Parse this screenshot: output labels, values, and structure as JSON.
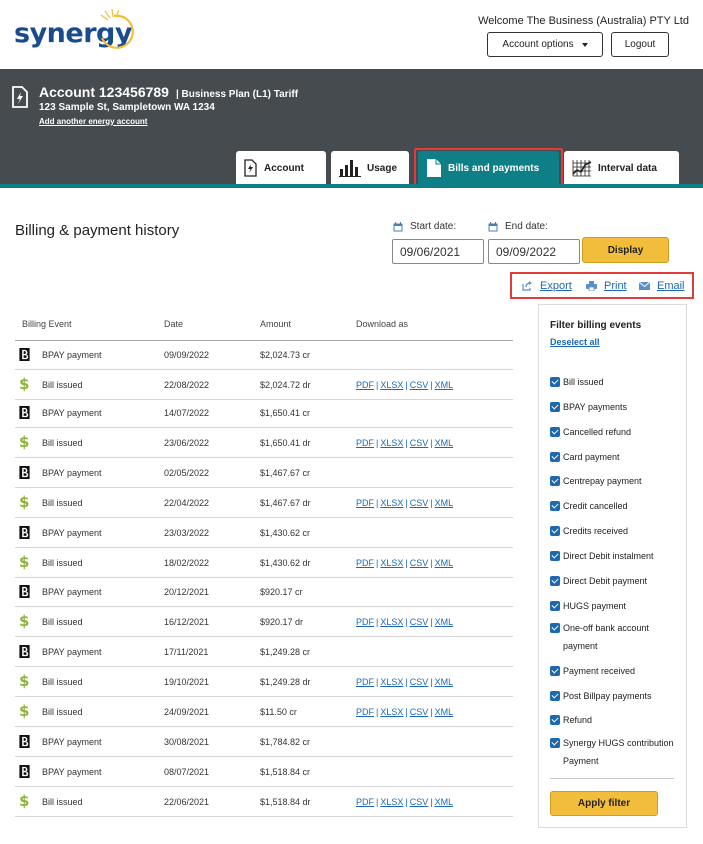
{
  "header": {
    "logo_text": "synergy",
    "welcome": "Welcome The Business (Australia) PTY Ltd",
    "account_options_label": "Account options",
    "logout_label": "Logout"
  },
  "account": {
    "number": "Account 123456789",
    "plan": "| Business Plan (L1) Tariff",
    "address": "123 Sample St, Sampletown WA 1234",
    "add_link": "Add another energy account"
  },
  "tabs": [
    {
      "label": "Account",
      "icon": "bolt-document-icon",
      "active": false
    },
    {
      "label": "Usage",
      "icon": "bar-chart-icon",
      "active": false
    },
    {
      "label": "Bills and payments",
      "icon": "document-icon",
      "active": true
    },
    {
      "label": "Interval data",
      "icon": "grid-chart-icon",
      "active": false
    }
  ],
  "billing": {
    "title": "Billing & payment history",
    "start_label": "Start date:",
    "end_label": "End date:",
    "start_value": "09/06/2021",
    "end_value": "09/09/2022",
    "display_label": "Display",
    "export_label": "Export",
    "print_label": "Print",
    "email_label": "Email"
  },
  "table": {
    "headers": [
      "Billing Event",
      "Date",
      "Amount",
      "Download as"
    ],
    "download_labels": [
      "PDF",
      "XLSX",
      "CSV",
      "XML"
    ],
    "rows": [
      {
        "type": "bpay",
        "event": "BPAY payment",
        "date": "09/09/2022",
        "amount": "$2,024.73 cr"
      },
      {
        "type": "bill",
        "event": "Bill issued",
        "date": "22/08/2022",
        "amount": "$2,024.72 dr"
      },
      {
        "type": "bpay",
        "event": "BPAY payment",
        "date": "14/07/2022",
        "amount": "$1,650.41 cr"
      },
      {
        "type": "bill",
        "event": "Bill issued",
        "date": "23/06/2022",
        "amount": "$1,650.41 dr"
      },
      {
        "type": "bpay",
        "event": "BPAY payment",
        "date": "02/05/2022",
        "amount": "$1,467.67 cr"
      },
      {
        "type": "bill",
        "event": "Bill issued",
        "date": "22/04/2022",
        "amount": "$1,467.67 dr"
      },
      {
        "type": "bpay",
        "event": "BPAY payment",
        "date": "23/03/2022",
        "amount": "$1,430.62 cr"
      },
      {
        "type": "bill",
        "event": "Bill issued",
        "date": "18/02/2022",
        "amount": "$1,430.62 dr"
      },
      {
        "type": "bpay",
        "event": "BPAY payment",
        "date": "20/12/2021",
        "amount": "$920.17 cr"
      },
      {
        "type": "bill",
        "event": "Bill issued",
        "date": "16/12/2021",
        "amount": "$920.17 dr"
      },
      {
        "type": "bpay",
        "event": "BPAY payment",
        "date": "17/11/2021",
        "amount": "$1,249.28 cr"
      },
      {
        "type": "bill",
        "event": "Bill issued",
        "date": "19/10/2021",
        "amount": "$1,249.28 dr"
      },
      {
        "type": "bill",
        "event": "Bill issued",
        "date": "24/09/2021",
        "amount": "$11.50 cr"
      },
      {
        "type": "bpay",
        "event": "BPAY payment",
        "date": "30/08/2021",
        "amount": "$1,784.82 cr"
      },
      {
        "type": "bpay",
        "event": "BPAY payment",
        "date": "08/07/2021",
        "amount": "$1,518.84 cr"
      },
      {
        "type": "bill",
        "event": "Bill issued",
        "date": "22/06/2021",
        "amount": "$1,518.84 dr"
      }
    ]
  },
  "filter": {
    "title": "Filter billing events",
    "deselect_label": "Deselect all",
    "items": [
      {
        "label": "Bill issued",
        "checked": true
      },
      {
        "label": "BPAY payments",
        "checked": true
      },
      {
        "label": "Cancelled refund",
        "checked": true
      },
      {
        "label": "Card payment",
        "checked": true
      },
      {
        "label": "Centrepay payment",
        "checked": true
      },
      {
        "label": "Credit cancelled",
        "checked": true
      },
      {
        "label": "Credits received",
        "checked": true
      },
      {
        "label": "Direct Debit instalment",
        "checked": true
      },
      {
        "label": "Direct Debit payment",
        "checked": true
      },
      {
        "label": "HUGS payment",
        "checked": true
      },
      {
        "label": "One-off bank account payment",
        "checked": true
      },
      {
        "label": "Payment received",
        "checked": true
      },
      {
        "label": "Post Billpay payments",
        "checked": true
      },
      {
        "label": "Refund",
        "checked": true
      },
      {
        "label": "Synergy HUGS contribution Payment",
        "checked": true
      }
    ],
    "apply_label": "Apply filter"
  },
  "colors": {
    "accent_teal": "#0e7f86",
    "band_gray": "#454b4f",
    "button_yellow": "#f2bd3a",
    "link_blue": "#1c68b1",
    "highlight_red": "#e03c3c",
    "dollar_green": "#8db33a"
  }
}
